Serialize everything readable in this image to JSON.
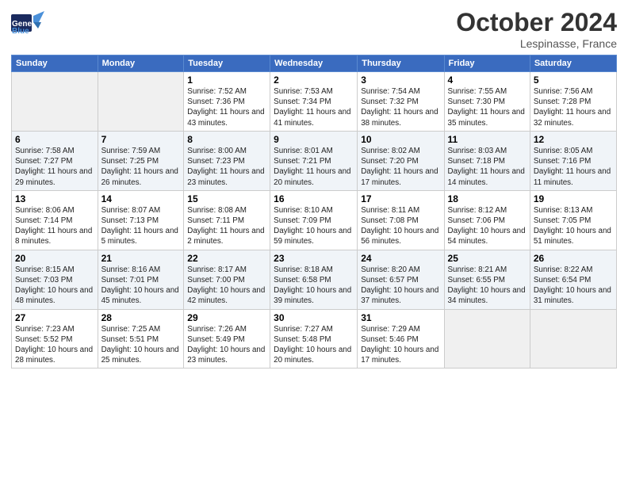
{
  "header": {
    "logo_general": "General",
    "logo_blue": "Blue",
    "month": "October 2024",
    "location": "Lespinasse, France"
  },
  "weekdays": [
    "Sunday",
    "Monday",
    "Tuesday",
    "Wednesday",
    "Thursday",
    "Friday",
    "Saturday"
  ],
  "weeks": [
    [
      {
        "day": "",
        "sunrise": "",
        "sunset": "",
        "daylight": ""
      },
      {
        "day": "",
        "sunrise": "",
        "sunset": "",
        "daylight": ""
      },
      {
        "day": "1",
        "sunrise": "Sunrise: 7:52 AM",
        "sunset": "Sunset: 7:36 PM",
        "daylight": "Daylight: 11 hours and 43 minutes."
      },
      {
        "day": "2",
        "sunrise": "Sunrise: 7:53 AM",
        "sunset": "Sunset: 7:34 PM",
        "daylight": "Daylight: 11 hours and 41 minutes."
      },
      {
        "day": "3",
        "sunrise": "Sunrise: 7:54 AM",
        "sunset": "Sunset: 7:32 PM",
        "daylight": "Daylight: 11 hours and 38 minutes."
      },
      {
        "day": "4",
        "sunrise": "Sunrise: 7:55 AM",
        "sunset": "Sunset: 7:30 PM",
        "daylight": "Daylight: 11 hours and 35 minutes."
      },
      {
        "day": "5",
        "sunrise": "Sunrise: 7:56 AM",
        "sunset": "Sunset: 7:28 PM",
        "daylight": "Daylight: 11 hours and 32 minutes."
      }
    ],
    [
      {
        "day": "6",
        "sunrise": "Sunrise: 7:58 AM",
        "sunset": "Sunset: 7:27 PM",
        "daylight": "Daylight: 11 hours and 29 minutes."
      },
      {
        "day": "7",
        "sunrise": "Sunrise: 7:59 AM",
        "sunset": "Sunset: 7:25 PM",
        "daylight": "Daylight: 11 hours and 26 minutes."
      },
      {
        "day": "8",
        "sunrise": "Sunrise: 8:00 AM",
        "sunset": "Sunset: 7:23 PM",
        "daylight": "Daylight: 11 hours and 23 minutes."
      },
      {
        "day": "9",
        "sunrise": "Sunrise: 8:01 AM",
        "sunset": "Sunset: 7:21 PM",
        "daylight": "Daylight: 11 hours and 20 minutes."
      },
      {
        "day": "10",
        "sunrise": "Sunrise: 8:02 AM",
        "sunset": "Sunset: 7:20 PM",
        "daylight": "Daylight: 11 hours and 17 minutes."
      },
      {
        "day": "11",
        "sunrise": "Sunrise: 8:03 AM",
        "sunset": "Sunset: 7:18 PM",
        "daylight": "Daylight: 11 hours and 14 minutes."
      },
      {
        "day": "12",
        "sunrise": "Sunrise: 8:05 AM",
        "sunset": "Sunset: 7:16 PM",
        "daylight": "Daylight: 11 hours and 11 minutes."
      }
    ],
    [
      {
        "day": "13",
        "sunrise": "Sunrise: 8:06 AM",
        "sunset": "Sunset: 7:14 PM",
        "daylight": "Daylight: 11 hours and 8 minutes."
      },
      {
        "day": "14",
        "sunrise": "Sunrise: 8:07 AM",
        "sunset": "Sunset: 7:13 PM",
        "daylight": "Daylight: 11 hours and 5 minutes."
      },
      {
        "day": "15",
        "sunrise": "Sunrise: 8:08 AM",
        "sunset": "Sunset: 7:11 PM",
        "daylight": "Daylight: 11 hours and 2 minutes."
      },
      {
        "day": "16",
        "sunrise": "Sunrise: 8:10 AM",
        "sunset": "Sunset: 7:09 PM",
        "daylight": "Daylight: 10 hours and 59 minutes."
      },
      {
        "day": "17",
        "sunrise": "Sunrise: 8:11 AM",
        "sunset": "Sunset: 7:08 PM",
        "daylight": "Daylight: 10 hours and 56 minutes."
      },
      {
        "day": "18",
        "sunrise": "Sunrise: 8:12 AM",
        "sunset": "Sunset: 7:06 PM",
        "daylight": "Daylight: 10 hours and 54 minutes."
      },
      {
        "day": "19",
        "sunrise": "Sunrise: 8:13 AM",
        "sunset": "Sunset: 7:05 PM",
        "daylight": "Daylight: 10 hours and 51 minutes."
      }
    ],
    [
      {
        "day": "20",
        "sunrise": "Sunrise: 8:15 AM",
        "sunset": "Sunset: 7:03 PM",
        "daylight": "Daylight: 10 hours and 48 minutes."
      },
      {
        "day": "21",
        "sunrise": "Sunrise: 8:16 AM",
        "sunset": "Sunset: 7:01 PM",
        "daylight": "Daylight: 10 hours and 45 minutes."
      },
      {
        "day": "22",
        "sunrise": "Sunrise: 8:17 AM",
        "sunset": "Sunset: 7:00 PM",
        "daylight": "Daylight: 10 hours and 42 minutes."
      },
      {
        "day": "23",
        "sunrise": "Sunrise: 8:18 AM",
        "sunset": "Sunset: 6:58 PM",
        "daylight": "Daylight: 10 hours and 39 minutes."
      },
      {
        "day": "24",
        "sunrise": "Sunrise: 8:20 AM",
        "sunset": "Sunset: 6:57 PM",
        "daylight": "Daylight: 10 hours and 37 minutes."
      },
      {
        "day": "25",
        "sunrise": "Sunrise: 8:21 AM",
        "sunset": "Sunset: 6:55 PM",
        "daylight": "Daylight: 10 hours and 34 minutes."
      },
      {
        "day": "26",
        "sunrise": "Sunrise: 8:22 AM",
        "sunset": "Sunset: 6:54 PM",
        "daylight": "Daylight: 10 hours and 31 minutes."
      }
    ],
    [
      {
        "day": "27",
        "sunrise": "Sunrise: 7:23 AM",
        "sunset": "Sunset: 5:52 PM",
        "daylight": "Daylight: 10 hours and 28 minutes."
      },
      {
        "day": "28",
        "sunrise": "Sunrise: 7:25 AM",
        "sunset": "Sunset: 5:51 PM",
        "daylight": "Daylight: 10 hours and 25 minutes."
      },
      {
        "day": "29",
        "sunrise": "Sunrise: 7:26 AM",
        "sunset": "Sunset: 5:49 PM",
        "daylight": "Daylight: 10 hours and 23 minutes."
      },
      {
        "day": "30",
        "sunrise": "Sunrise: 7:27 AM",
        "sunset": "Sunset: 5:48 PM",
        "daylight": "Daylight: 10 hours and 20 minutes."
      },
      {
        "day": "31",
        "sunrise": "Sunrise: 7:29 AM",
        "sunset": "Sunset: 5:46 PM",
        "daylight": "Daylight: 10 hours and 17 minutes."
      },
      {
        "day": "",
        "sunrise": "",
        "sunset": "",
        "daylight": ""
      },
      {
        "day": "",
        "sunrise": "",
        "sunset": "",
        "daylight": ""
      }
    ]
  ]
}
